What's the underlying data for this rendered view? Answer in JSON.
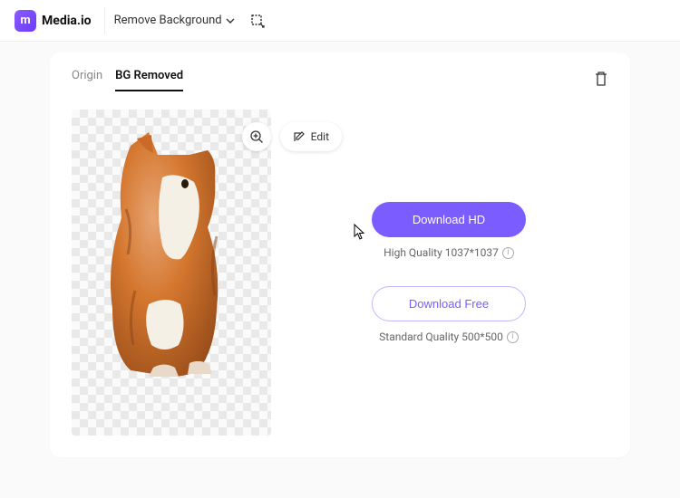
{
  "header": {
    "brand": "Media.io",
    "logo_letter": "m",
    "tool_name": "Remove Background"
  },
  "tabs": {
    "origin": "Origin",
    "removed": "BG Removed"
  },
  "controls": {
    "edit_label": "Edit"
  },
  "download": {
    "hd_label": "Download HD",
    "hd_info": "High Quality 1037*1037",
    "free_label": "Download Free",
    "free_info": "Standard Quality 500*500"
  },
  "colors": {
    "accent": "#7a5cff"
  }
}
